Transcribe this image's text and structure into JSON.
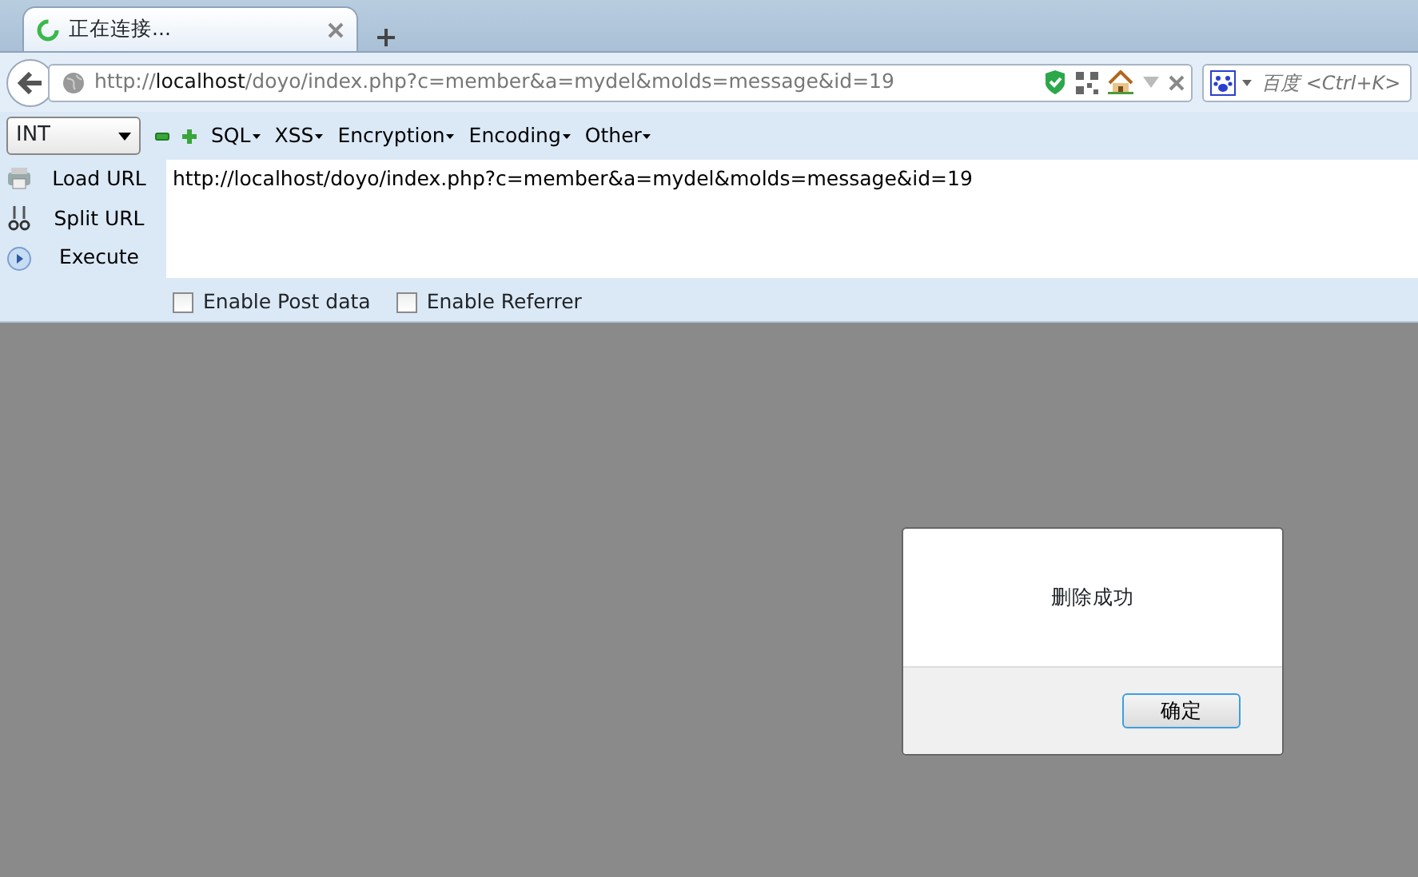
{
  "tab": {
    "title": "正在连接...",
    "loading": true
  },
  "address_bar": {
    "scheme": "http://",
    "host": "localhost",
    "path": "/doyo/index.php?c=member&a=mydel&molds=message&id=19"
  },
  "search_box": {
    "placeholder": "百度 <Ctrl+K>"
  },
  "hackbar": {
    "type_select": "INT",
    "menus": [
      "SQL",
      "XSS",
      "Encryption",
      "Encoding",
      "Other"
    ],
    "actions": [
      {
        "kind": "load",
        "label": "Load URL"
      },
      {
        "kind": "split",
        "label": "Split URL"
      },
      {
        "kind": "execute",
        "label": "Execute"
      }
    ],
    "url_text": "http://localhost/doyo/index.php?c=member&a=mydel&molds=message&id=19",
    "options": [
      {
        "label": "Enable Post data",
        "checked": false
      },
      {
        "label": "Enable Referrer",
        "checked": false
      }
    ]
  },
  "alert": {
    "message": "删除成功",
    "button": "确定"
  }
}
